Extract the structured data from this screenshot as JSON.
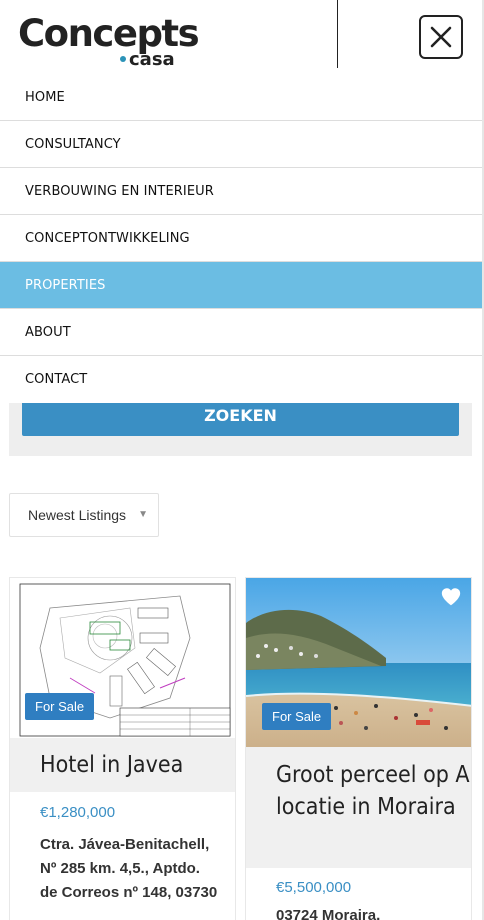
{
  "brand": {
    "name": "Concepts",
    "sub": "casa",
    "accent": "#2b93b8"
  },
  "menu": {
    "close_icon": "close-icon",
    "items": [
      {
        "label": "HOME"
      },
      {
        "label": "CONSULTANCY"
      },
      {
        "label": "VERBOUWING EN INTERIEUR"
      },
      {
        "label": "CONCEPTONTWIKKELING"
      },
      {
        "label": "PROPERTIES",
        "active": true
      },
      {
        "label": "ABOUT"
      },
      {
        "label": "CONTACT"
      }
    ],
    "active_color": "#6bbde3"
  },
  "search": {
    "button_label": "ZOEKEN",
    "button_color": "#3a8fc4"
  },
  "sort": {
    "selected": "Newest Listings"
  },
  "listings": [
    {
      "badge": "For Sale",
      "title": "Hotel in Javea",
      "price": "€1,280,000",
      "address": "Ctra. Jávea-Benitachell, Nº 285 km. 4,5., Aptdo. de Correos nº 148, 03730",
      "image": "floor-plan-drawing"
    },
    {
      "badge": "For Sale",
      "title": "Groot perceel op A locatie in Moraira",
      "price": "€5,500,000",
      "address": "03724 Moraira,",
      "image": "beach-photo",
      "favorite_icon": "heart-icon"
    }
  ]
}
